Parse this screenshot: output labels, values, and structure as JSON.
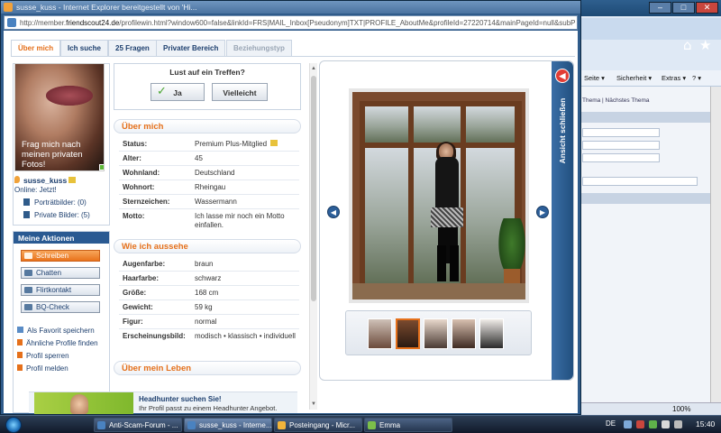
{
  "bg_window": {
    "caption_buttons": [
      "–",
      "□",
      "✕"
    ],
    "menu": [
      "Seite ▾",
      "Sicherheit ▾",
      "Extras ▾",
      "? ▾"
    ],
    "subtext": "Thema | Nächstes Thema",
    "status_zoom": "100%"
  },
  "popup": {
    "title": "susse_kuss - Internet Explorer bereitgestellt von 'Hi...",
    "url_prefix": "http://member.",
    "url_domain": "friendscout24.de",
    "url_rest": "/profilewin.html?window600=false&linkId=FRS|MAIL_Inbox[Pseudonym]TXT|PROFILE_AboutMe&profileId=27220714&mainPageId=null&subPageId=null&"
  },
  "tabs": [
    {
      "label": "Über mich",
      "state": "active"
    },
    {
      "label": "Ich suche",
      "state": "normal"
    },
    {
      "label": "25 Fragen",
      "state": "normal"
    },
    {
      "label": "Privater Bereich",
      "state": "normal"
    },
    {
      "label": "Beziehungstyp",
      "state": "disabled"
    }
  ],
  "profile": {
    "photo_caption": "Frag mich nach meinen privaten Fotos!",
    "username": "susse_kuss",
    "online": "Online: Jetzt!",
    "portrait_pics": "Porträtbilder: (0)",
    "private_pics": "Private Bilder: (5)"
  },
  "actions": {
    "header": "Meine Aktionen",
    "buttons": [
      "Schreiben",
      "Chatten",
      "Flirtkontakt",
      "BQ-Check"
    ],
    "links": [
      "Als Favorit speichern",
      "Ähnliche Profile finden",
      "Profil sperren",
      "Profil melden"
    ]
  },
  "meet": {
    "title": "Lust auf ein Treffen?",
    "yes": "Ja",
    "maybe": "Vielleicht"
  },
  "about": {
    "header": "Über mich",
    "rows": [
      {
        "label": "Status:",
        "value": "Premium Plus-Mitglied"
      },
      {
        "label": "Alter:",
        "value": "45"
      },
      {
        "label": "Wohnland:",
        "value": "Deutschland"
      },
      {
        "label": "Wohnort:",
        "value": "Rheingau"
      },
      {
        "label": "Sternzeichen:",
        "value": "Wassermann"
      },
      {
        "label": "Motto:",
        "value": "Ich lasse mir noch ein Motto einfallen."
      }
    ]
  },
  "looks": {
    "header": "Wie ich aussehe",
    "rows": [
      {
        "label": "Augenfarbe:",
        "value": "braun"
      },
      {
        "label": "Haarfarbe:",
        "value": "schwarz"
      },
      {
        "label": "Größe:",
        "value": "168 cm"
      },
      {
        "label": "Gewicht:",
        "value": "59 kg"
      },
      {
        "label": "Figur:",
        "value": "normal"
      },
      {
        "label": "Erscheinungsbild:",
        "value": "modisch • klassisch • individuell"
      }
    ]
  },
  "life": {
    "header": "Über mein Leben"
  },
  "viewer": {
    "close_label": "Ansicht schließen",
    "prev": "◀",
    "next": "▶",
    "selected_thumbnail": 2,
    "thumbnail_count": 5
  },
  "ad": {
    "title": "Headhunter suchen Sie!",
    "text": "Ihr Profil passt zu einem Headhunter Angebot."
  },
  "taskbar": {
    "items": [
      "Anti-Scam-Forum - ...",
      "susse_kuss - Interne...",
      "Posteingang - Micr...",
      "Emma"
    ],
    "lang": "DE",
    "clock": "15:40"
  },
  "colors": {
    "accent_orange": "#e5701b",
    "brand_blue": "#1d3f6e",
    "header_blue": "#2a5a92"
  }
}
